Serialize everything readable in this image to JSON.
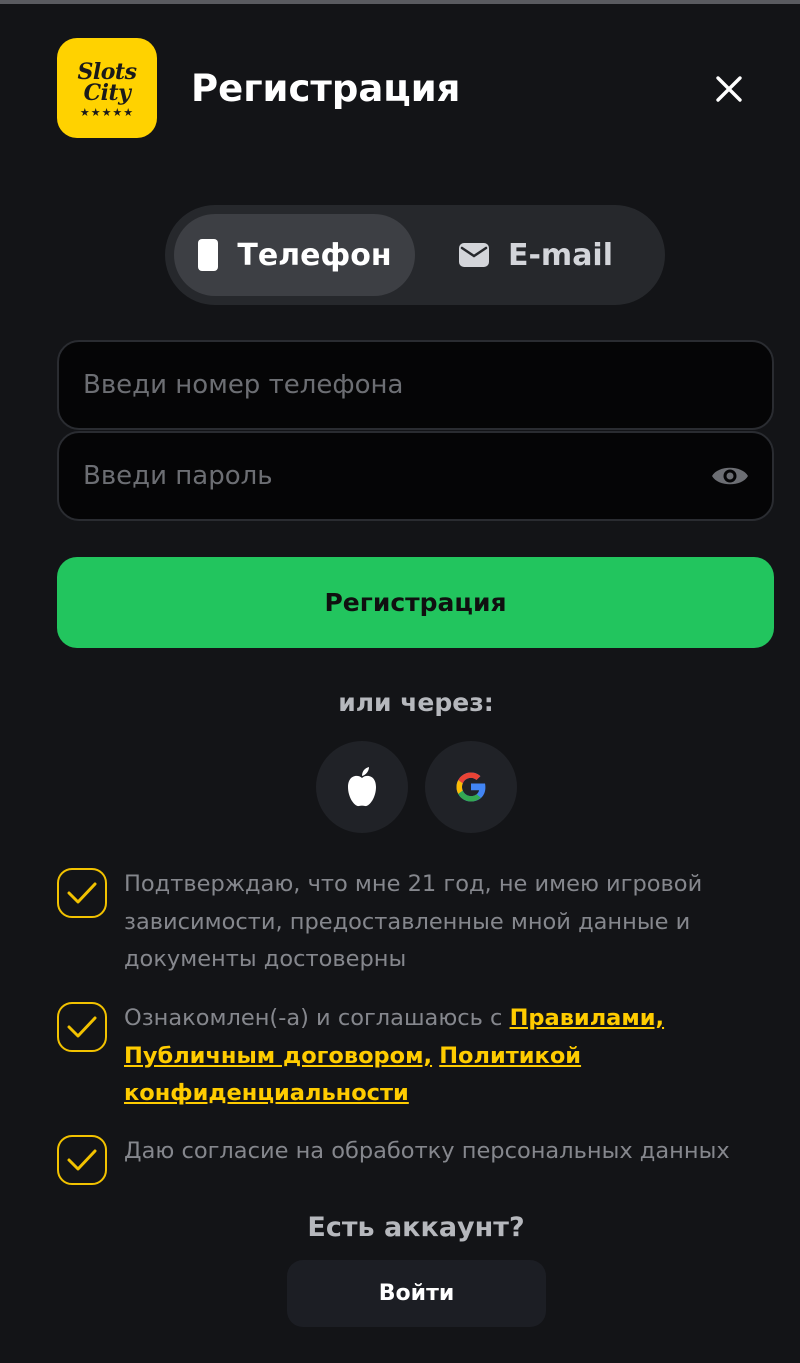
{
  "header": {
    "logo_line1": "Slots",
    "logo_line2": "City",
    "logo_stars": "★★★★★",
    "title": "Регистрация"
  },
  "tabs": [
    {
      "label": "Телефон",
      "active": true,
      "icon": "phone-icon"
    },
    {
      "label": "E-mail",
      "active": false,
      "icon": "envelope-icon"
    }
  ],
  "form": {
    "phone_placeholder": "Введи номер телефона",
    "phone_value": "",
    "password_placeholder": "Введи пароль",
    "password_value": "",
    "submit_label": "Регистрация"
  },
  "social": {
    "or_label": "или через:",
    "providers": [
      "apple-icon",
      "google-icon"
    ]
  },
  "consents": [
    {
      "checked": true,
      "text": "Подтверждаю, что мне 21 год, не имею игровой зависимости, предоставленные мной данные и документы достоверны"
    },
    {
      "checked": true,
      "text_prefix": "Ознакомлен(-а) и соглашаюсь с ",
      "links": [
        "Правилами,",
        "Публичным договором,",
        "Политикой конфиденциальности"
      ]
    },
    {
      "checked": true,
      "text": "Даю согласие на обработку персональных данных"
    }
  ],
  "footer": {
    "have_account": "Есть аккаунт?",
    "login_label": "Войти"
  },
  "colors": {
    "background": "#131417",
    "brand_yellow": "#ffd200",
    "accent_green": "#22c55e",
    "link_yellow": "#ffcc00"
  }
}
